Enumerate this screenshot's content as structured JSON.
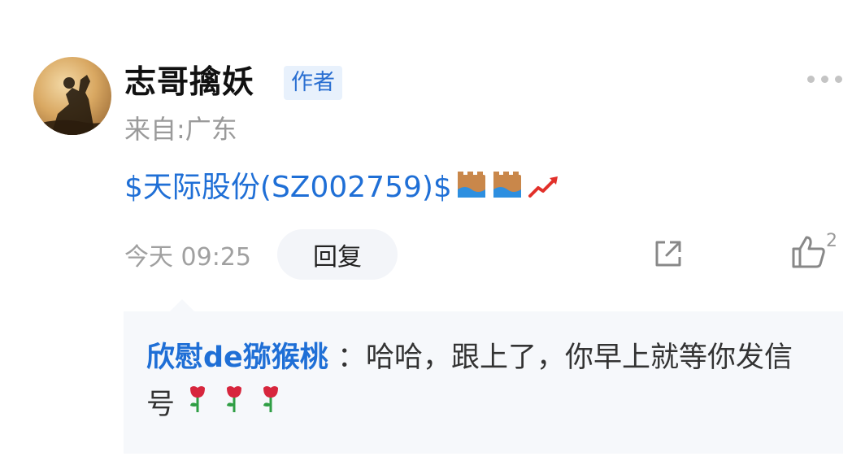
{
  "post": {
    "author_name": "志哥擒妖",
    "author_badge": "作者",
    "origin": "来自:广东",
    "stock_link": "$天际股份(SZ002759)$",
    "stock_emojis": [
      "castle-water-icon",
      "castle-water-icon",
      "rising-chart-icon"
    ],
    "timestamp": "今天 09:25",
    "reply_label": "回复",
    "like_count": "2"
  },
  "reply": {
    "user": "欣慰de猕猴桃",
    "separator": "：",
    "text": "哈哈，跟上了，你早上就等你发信号",
    "emojis": [
      "rose-icon",
      "rose-icon",
      "rose-icon"
    ]
  },
  "colors": {
    "link_blue": "#1f6fd6",
    "badge_bg": "#e8f1fc",
    "reply_bg": "#f6f8fb",
    "muted_text": "#9a9a9a"
  }
}
